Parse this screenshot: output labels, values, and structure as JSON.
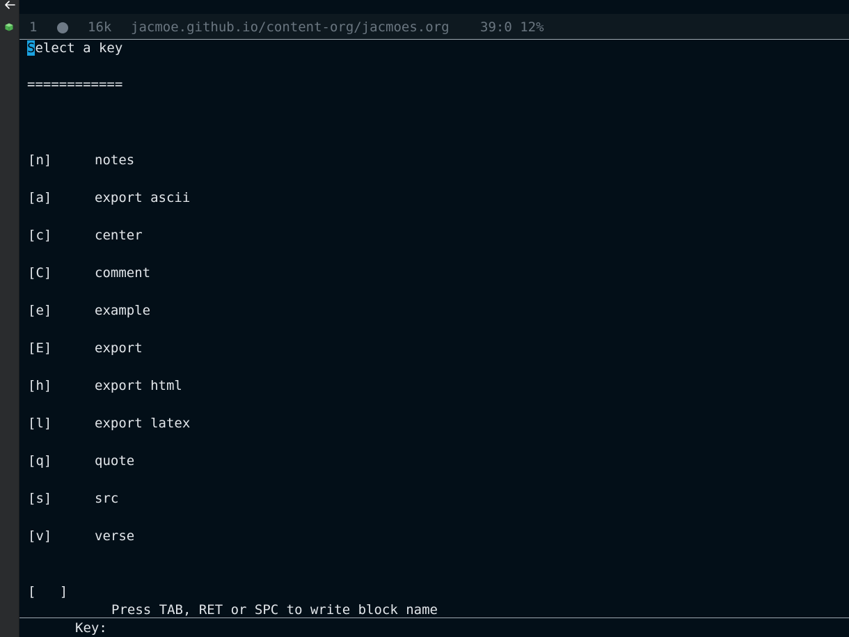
{
  "modeline": {
    "window_number": "1",
    "size": "16k",
    "buffer_path": "jacmoe.github.io/content-org/jacmoes.org",
    "position": "39:0 12%"
  },
  "dispatcher": {
    "title_first_char": "S",
    "title_rest": "elect a key",
    "underline": "============",
    "options": [
      {
        "key": "[n]",
        "label": "notes"
      },
      {
        "key": "[a]",
        "label": "export ascii"
      },
      {
        "key": "[c]",
        "label": "center"
      },
      {
        "key": "[C]",
        "label": "comment"
      },
      {
        "key": "[e]",
        "label": "example"
      },
      {
        "key": "[E]",
        "label": "export"
      },
      {
        "key": "[h]",
        "label": "export html"
      },
      {
        "key": "[l]",
        "label": "export latex"
      },
      {
        "key": "[q]",
        "label": "quote"
      },
      {
        "key": "[s]",
        "label": "src"
      },
      {
        "key": "[v]",
        "label": "verse"
      }
    ],
    "other": {
      "key": "[   ]",
      "label": "Press TAB, RET or SPC to write block name"
    }
  },
  "minibuffer": {
    "prompt": "Key:",
    "value": ""
  },
  "colors": {
    "background": "#030f18",
    "cursor": "#1aa2e0",
    "foreground": "#e2e6ea",
    "modeline_text": "#6a7680",
    "icon_green": "#4caf50"
  },
  "icons": {
    "back": "arrow-left-icon",
    "gutter": "cube-icon",
    "modified": "circle-dot-icon"
  }
}
